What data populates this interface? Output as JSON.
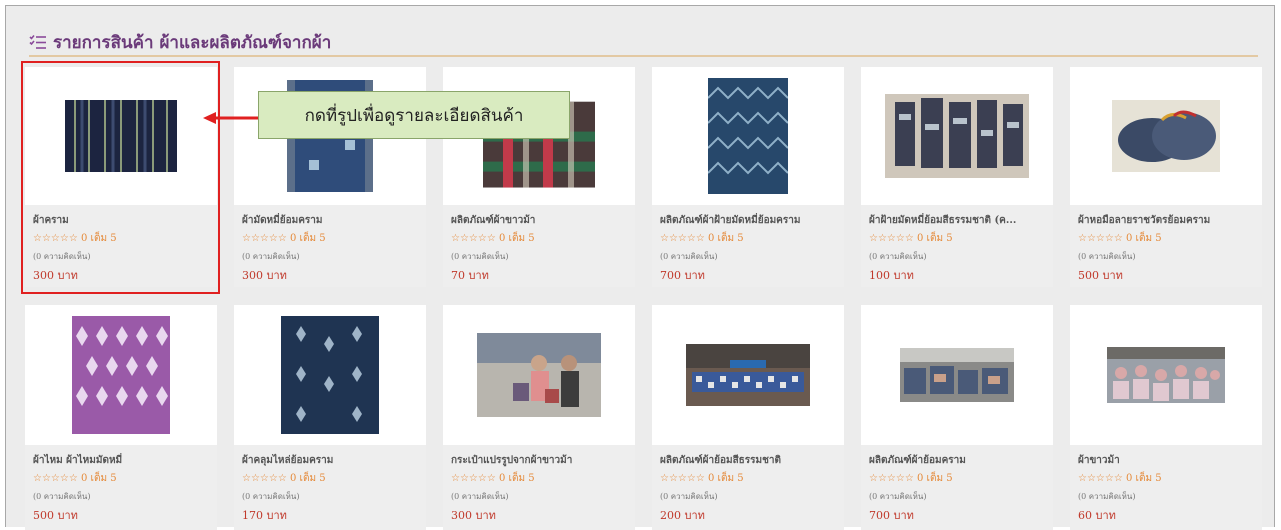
{
  "header": {
    "title": "รายการสินค้า ผ้าและผลิตภัณฑ์จากผ้า",
    "icon": "list-icon"
  },
  "callout": {
    "text": "กดที่รูปเพื่อดูรายละเอียดสินค้า"
  },
  "colors": {
    "title": "#6b3a7a",
    "price": "#c0392b",
    "stars": "#e58a3a",
    "callout_bg": "#d9ebc0",
    "highlight": "#e02020"
  },
  "rating_text": "☆☆☆☆☆ 0 เต็ม 5",
  "reviews_text": "(0 ความคิดเห็น)",
  "products_row1": [
    {
      "name": "ผ้าคราม",
      "price": "300 บาท"
    },
    {
      "name": "ผ้ามัดหมี่ย้อมคราม",
      "price": "300 บาท"
    },
    {
      "name": "ผลิตภัณฑ์ผ้าขาวม้า",
      "price": "70 บาท"
    },
    {
      "name": "ผลิตภัณฑ์ผ้าฝ้ายมัดหมี่ย้อมคราม",
      "price": "700 บาท"
    },
    {
      "name": "ผ้าฝ้ายมัดหมี่ย้อมสีธรรมชาติ (ค...",
      "price": "100 บาท"
    },
    {
      "name": "ผ้าหอมือลายราชวัตรย้อมคราม",
      "price": "500 บาท"
    }
  ],
  "products_row2": [
    {
      "name": "ผ้าไหม ผ้าไหมมัดหมี่",
      "price": "500 บาท"
    },
    {
      "name": "ผ้าคลุมไหล่ย้อมคราม",
      "price": "170 บาท"
    },
    {
      "name": "กระเป๋าแปรรูปจากผ้าขาวม้า",
      "price": "300 บาท"
    },
    {
      "name": "ผลิตภัณฑ์ผ้าย้อมสีธรรมชาติ",
      "price": "200 บาท"
    },
    {
      "name": "ผลิตภัณฑ์ผ้าย้อมคราม",
      "price": "700 บาท"
    },
    {
      "name": "ผ้าขาวม้า",
      "price": "60 บาท"
    }
  ]
}
